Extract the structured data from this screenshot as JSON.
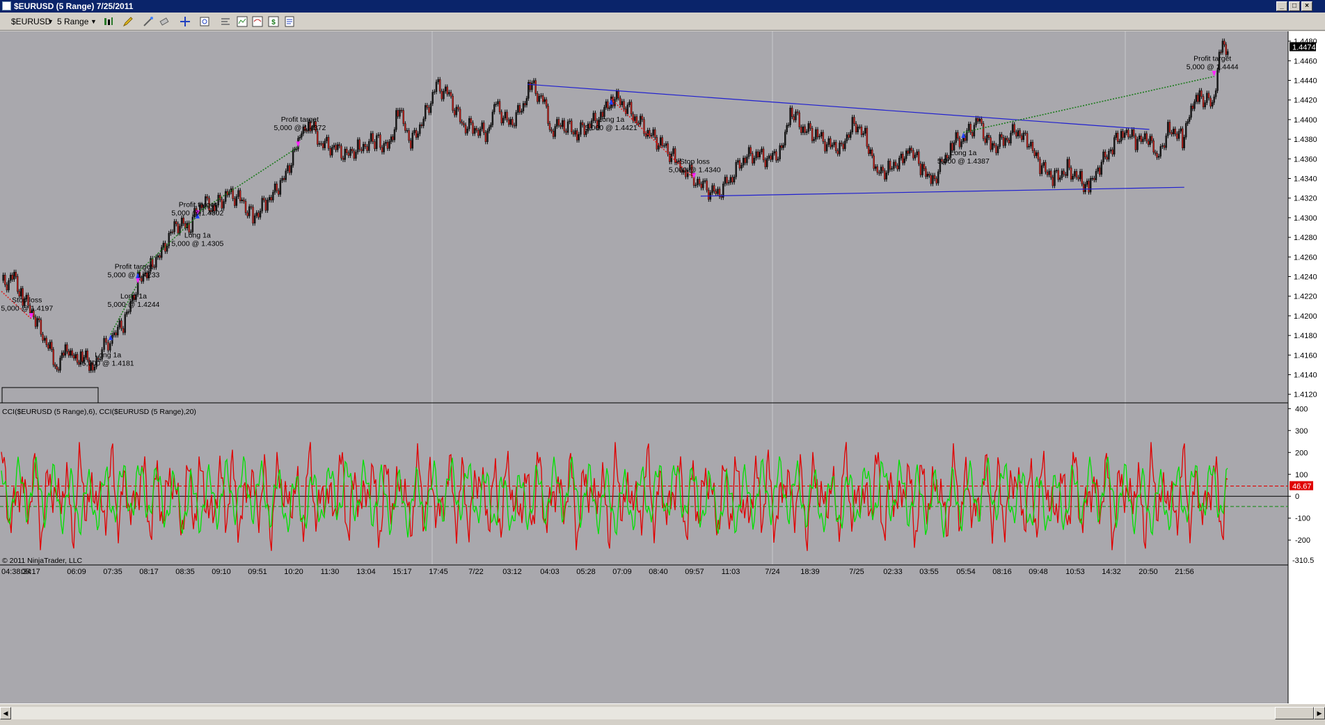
{
  "window": {
    "title": "$EURUSD (5 Range)  7/25/2011",
    "min_label": "_",
    "max_label": "□",
    "close_label": "×"
  },
  "toolbar": {
    "instrument": "$EURUSD",
    "period": "5 Range"
  },
  "colors": {
    "chart_bg": "#a9a8ad",
    "axis_bg": "#ffffff",
    "up_bar": "#1a1a1a",
    "down_bar": "#c0201a",
    "trendline": "#2020d0",
    "cci_fast": "#e00000",
    "cci_slow": "#00e000",
    "profit_line": "#1a7a1a",
    "loss_line": "#e02020",
    "entry_marker": "#2040ff",
    "exit_marker": "#ff20ff"
  },
  "chart_data": [
    {
      "type": "line",
      "name": "price",
      "yticks": [
        "1.4120",
        "1.4140",
        "1.4160",
        "1.4180",
        "1.4200",
        "1.4220",
        "1.4240",
        "1.4260",
        "1.4280",
        "1.4300",
        "1.4320",
        "1.4340",
        "1.4360",
        "1.4380",
        "1.4400",
        "1.4420",
        "1.4440",
        "1.4460",
        "1.4480"
      ],
      "ylim": [
        1.4112,
        1.449
      ],
      "last_price_label": "1.4474",
      "x_ticks": [
        "04:38:34",
        "05:17",
        "06:09",
        "07:35",
        "08:17",
        "08:35",
        "09:10",
        "09:51",
        "10:20",
        "11:30",
        "13:04",
        "15:17",
        "17:45",
        "7/22",
        "03:12",
        "04:03",
        "05:28",
        "07:09",
        "08:40",
        "09:57",
        "11:03",
        "7/24",
        "18:39",
        "7/25",
        "02:33",
        "03:55",
        "05:54",
        "08:16",
        "09:48",
        "10:53",
        "14:32",
        "20:50",
        "21:56"
      ],
      "path_points": [
        [
          0,
          1.4232
        ],
        [
          15,
          1.424
        ],
        [
          25,
          1.422
        ],
        [
          40,
          1.4195
        ],
        [
          55,
          1.4168
        ],
        [
          65,
          1.415
        ],
        [
          75,
          1.4165
        ],
        [
          85,
          1.4155
        ],
        [
          95,
          1.4162
        ],
        [
          105,
          1.4145
        ],
        [
          118,
          1.4165
        ],
        [
          130,
          1.4178
        ],
        [
          145,
          1.4195
        ],
        [
          160,
          1.4235
        ],
        [
          175,
          1.425
        ],
        [
          190,
          1.427
        ],
        [
          205,
          1.4295
        ],
        [
          220,
          1.429
        ],
        [
          235,
          1.4315
        ],
        [
          250,
          1.431
        ],
        [
          265,
          1.4325
        ],
        [
          280,
          1.432
        ],
        [
          295,
          1.43
        ],
        [
          310,
          1.4315
        ],
        [
          325,
          1.433
        ],
        [
          340,
          1.4355
        ],
        [
          350,
          1.4385
        ],
        [
          360,
          1.4398
        ],
        [
          375,
          1.4375
        ],
        [
          390,
          1.4372
        ],
        [
          405,
          1.4365
        ],
        [
          420,
          1.4372
        ],
        [
          440,
          1.4378
        ],
        [
          455,
          1.4372
        ],
        [
          465,
          1.4412
        ],
        [
          480,
          1.4375
        ],
        [
          495,
          1.44
        ],
        [
          510,
          1.4435
        ],
        [
          525,
          1.4425
        ],
        [
          540,
          1.4395
        ],
        [
          555,
          1.439
        ],
        [
          570,
          1.4385
        ],
        [
          580,
          1.4415
        ],
        [
          595,
          1.4395
        ],
        [
          610,
          1.441
        ],
        [
          620,
          1.4435
        ],
        [
          635,
          1.442
        ],
        [
          645,
          1.4392
        ],
        [
          660,
          1.4395
        ],
        [
          675,
          1.4385
        ],
        [
          690,
          1.4395
        ],
        [
          705,
          1.4405
        ],
        [
          715,
          1.4425
        ],
        [
          730,
          1.4415
        ],
        [
          745,
          1.44
        ],
        [
          760,
          1.4385
        ],
        [
          775,
          1.4375
        ],
        [
          790,
          1.436
        ],
        [
          800,
          1.435
        ],
        [
          812,
          1.434
        ],
        [
          825,
          1.433
        ],
        [
          840,
          1.4325
        ],
        [
          855,
          1.434
        ],
        [
          870,
          1.436
        ],
        [
          885,
          1.4365
        ],
        [
          900,
          1.436
        ],
        [
          915,
          1.437
        ],
        [
          925,
          1.441
        ],
        [
          940,
          1.439
        ],
        [
          955,
          1.4385
        ],
        [
          970,
          1.4375
        ],
        [
          985,
          1.4372
        ],
        [
          1000,
          1.4398
        ],
        [
          1015,
          1.438
        ],
        [
          1025,
          1.4345
        ],
        [
          1040,
          1.435
        ],
        [
          1055,
          1.436
        ],
        [
          1065,
          1.437
        ],
        [
          1080,
          1.435
        ],
        [
          1090,
          1.4335
        ],
        [
          1105,
          1.4358
        ],
        [
          1115,
          1.4375
        ],
        [
          1130,
          1.4382
        ],
        [
          1145,
          1.44
        ],
        [
          1160,
          1.4372
        ],
        [
          1175,
          1.4378
        ],
        [
          1190,
          1.4388
        ],
        [
          1205,
          1.4375
        ],
        [
          1220,
          1.435
        ],
        [
          1235,
          1.434
        ],
        [
          1250,
          1.435
        ],
        [
          1265,
          1.434
        ],
        [
          1275,
          1.433
        ],
        [
          1290,
          1.4355
        ],
        [
          1305,
          1.4375
        ],
        [
          1315,
          1.439
        ],
        [
          1330,
          1.4378
        ],
        [
          1345,
          1.438
        ],
        [
          1355,
          1.4362
        ],
        [
          1370,
          1.4392
        ],
        [
          1385,
          1.438
        ],
        [
          1395,
          1.441
        ],
        [
          1405,
          1.4425
        ],
        [
          1420,
          1.4415
        ],
        [
          1430,
          1.447
        ],
        [
          1440,
          1.4474
        ]
      ],
      "annotations": [
        {
          "text1": "Stop loss",
          "text2": "5,000 @ 1.4197"
        },
        {
          "text1": "Long 1a",
          "text2": "5,000 @ 1.4181"
        },
        {
          "text1": "Profit target",
          "text2": "5,000 @ 1.4233"
        },
        {
          "text1": "Long 1a",
          "text2": "5,000 @ 1.4244"
        },
        {
          "text1": "Profit target",
          "text2": "5,000 @ 1.4302"
        },
        {
          "text1": "Long 1a",
          "text2": "5,000 @ 1.4305"
        },
        {
          "text1": "Profit target",
          "text2": "5,000 @ 1.4372"
        },
        {
          "text1": "Long 1a",
          "text2": "5,000 @ 1.4421"
        },
        {
          "text1": "Stop loss",
          "text2": "5,000 @ 1.4340"
        },
        {
          "text1": "Long 1a",
          "text2": "5,000 @ 1.4387"
        },
        {
          "text1": "Profit target",
          "text2": "5,000 @ 1.4444"
        }
      ]
    },
    {
      "type": "line",
      "name": "cci",
      "title": "CCI($EURUSD (5 Range),6), CCI($EURUSD (5 Range),20)",
      "yticks": [
        "400",
        "300",
        "200",
        "100",
        "0",
        "-100",
        "-200"
      ],
      "ylim": [
        -310.5,
        420
      ],
      "min_label": "-310.5",
      "last_value_label": "46.67",
      "upper_level": 46.67,
      "lower_level": -46.67,
      "footer": "© 2011 NinjaTrader, LLC"
    }
  ]
}
